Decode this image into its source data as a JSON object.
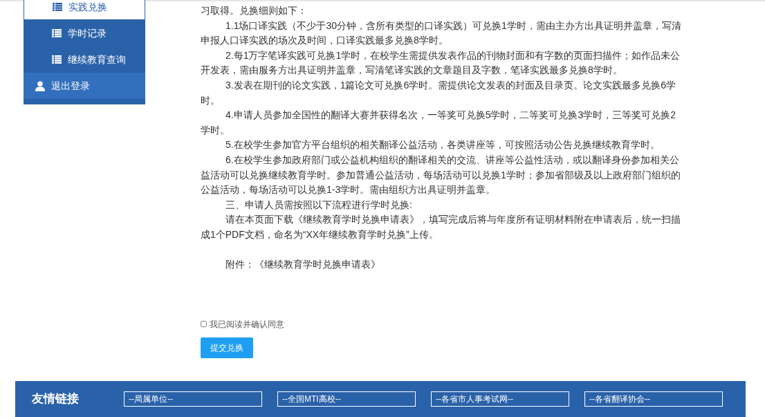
{
  "sidebar": {
    "items": [
      {
        "label": "实践兑换",
        "kind": "sub",
        "selected": true
      },
      {
        "label": "学时记录",
        "kind": "sub",
        "selected": false
      },
      {
        "label": "继续教育查询",
        "kind": "sub",
        "selected": false
      },
      {
        "label": "退出登录",
        "kind": "logout",
        "selected": false
      }
    ]
  },
  "content": {
    "paragraphs": [
      {
        "kind": "continuation",
        "text": "习取得。兑换细则如下："
      },
      {
        "kind": "item",
        "text": "1.1场口译实践（不少于30分钟，含所有类型的口译实践）可兑换1学时，需由主办方出具证明并盖章，写清申报人口译实践的场次及时间，口译实践最多兑换8学时。"
      },
      {
        "kind": "item",
        "text": "2.每1万字笔译实践可兑换1学时，在校学生需提供发表作品的刊物封面和有字数的页面扫描件；如作品未公开发表，需由服务方出具证明并盖章，写清笔译实践的文章题目及字数，笔译实践最多兑换8学时。"
      },
      {
        "kind": "item",
        "text": "3.发表在期刊的论文实践，1篇论文可兑换6学时。需提供论文发表的封面及目录页。论文实践最多兑换6学时。"
      },
      {
        "kind": "item",
        "text": "4.申请人员参加全国性的翻译大赛并获得名次，一等奖可兑换5学时，二等奖可兑换3学时，三等奖可兑换2学时。"
      },
      {
        "kind": "item",
        "text": "5.在校学生参加官方平台组织的相关翻译公益活动，各类讲座等，可按照活动公告兑换继续教育学时。"
      },
      {
        "kind": "item",
        "text": "6.在校学生参加政府部门或公益机构组织的翻译相关的交流、讲座等公益性活动，或以翻译身份参加相关公益活动可以兑换继续教育学时。参加普通公益活动，每场活动可以兑换1学时；参加省部级及以上政府部门组织的公益活动，每场活动可以兑换1-3学时。需由组织方出具证明并盖章。"
      },
      {
        "kind": "item",
        "text": "三、申请人员需按照以下流程进行学时兑换:"
      },
      {
        "kind": "item",
        "text": "请在本页面下载《继续教育学时兑换申请表》，填写完成后将与年度所有证明材料附在申请表后，统一扫描成1个PDF文档，命名为“XX年继续教育学时兑换”上传。"
      },
      {
        "kind": "attachment",
        "text": "附件：《继续教育学时兑换申请表》"
      }
    ],
    "agree": {
      "label": "我已阅读并确认同意",
      "checked": false
    },
    "submit": "提交兑换"
  },
  "footer": {
    "title": "友情链接",
    "dropdowns": [
      "--局属单位--",
      "--全国MTI高校--",
      "--各省市人事考试网--",
      "--各省翻译协会--"
    ]
  }
}
